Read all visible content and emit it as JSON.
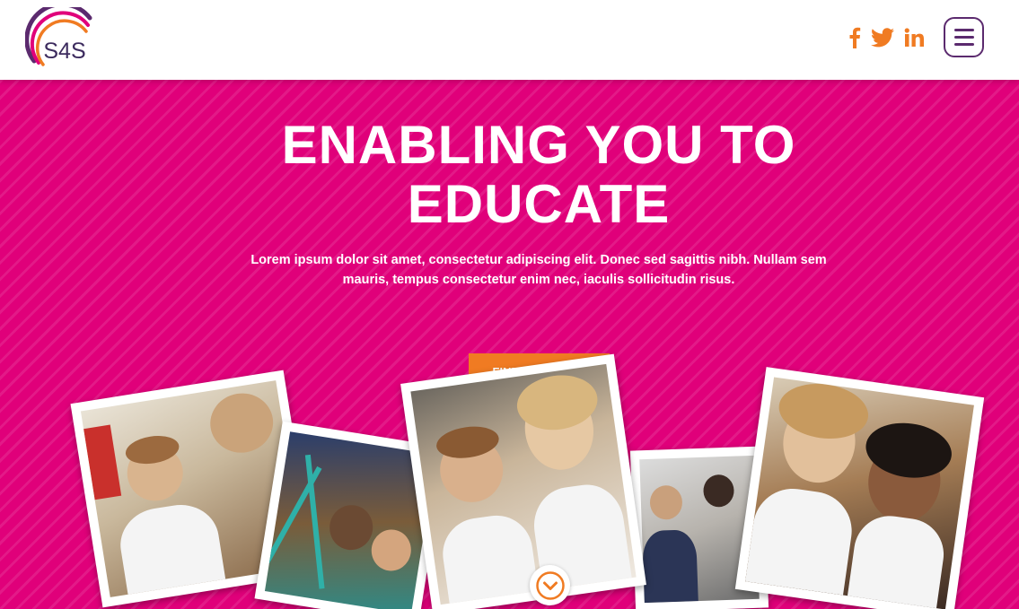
{
  "header": {
    "logo_text": "S4S",
    "social": [
      {
        "icon": "facebook-icon"
      },
      {
        "icon": "twitter-icon"
      },
      {
        "icon": "linkedin-icon"
      }
    ],
    "menu_icon": "hamburger-menu-icon"
  },
  "hero": {
    "title": "ENABLING YOU TO EDUCATE",
    "subtitle": "Lorem ipsum dolor sit amet, consectetur adipiscing elit. Donec sed sagittis nibh. Nullam sem mauris, tempus consectetur enim nec, iaculis sollicitudin risus.",
    "cta_label": "FIND OUT MORE",
    "scroll_icon": "chevron-down-circle-icon"
  },
  "colors": {
    "hero_background": "#e0007a",
    "accent_orange": "#f07b22",
    "brand_purple": "#5b2a6e"
  }
}
